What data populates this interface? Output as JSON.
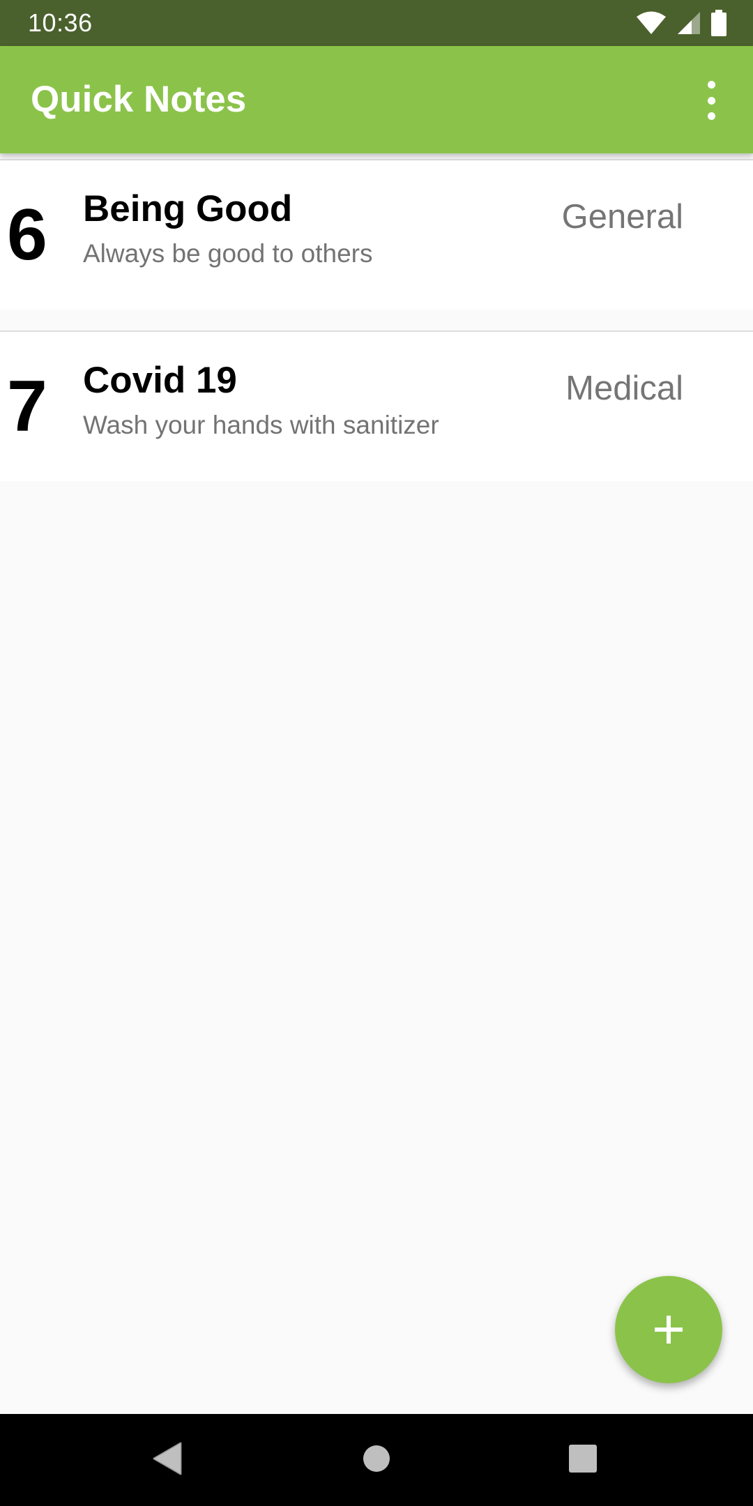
{
  "status_bar": {
    "time": "10:36",
    "icons": [
      "wifi-icon",
      "cellular-signal-icon",
      "battery-icon"
    ],
    "background": "#4b612d"
  },
  "app_bar": {
    "title": "Quick Notes",
    "menu_icon": "more-vert-icon",
    "background": "#8bc34a"
  },
  "notes": [
    {
      "priority": "6",
      "title": "Being Good",
      "description": "Always be good to others",
      "category": "General"
    },
    {
      "priority": "7",
      "title": "Covid 19",
      "description": "Wash your hands with sanitizer",
      "category": "Medical"
    }
  ],
  "fab": {
    "icon": "plus-icon",
    "color": "#8bc34a"
  },
  "nav_bar": {
    "buttons": [
      "back-icon",
      "home-icon",
      "recents-icon"
    ]
  }
}
